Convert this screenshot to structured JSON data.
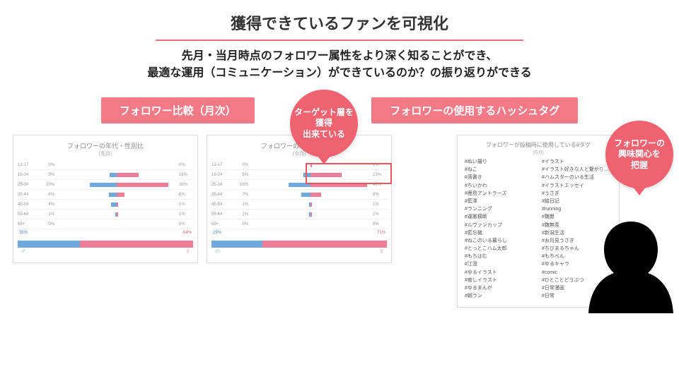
{
  "header": {
    "title": "獲得できているファンを可視化",
    "subtitle_l1": "先月・当月時点のフォロワー属性をより深く知ることができ、",
    "subtitle_l2": "最適な運用（コミュニケーション）ができているのか？の振り返りができる"
  },
  "tags": {
    "left": "フォロワー比較（月次）",
    "right": "フォロワーの使用するハッシュタグ"
  },
  "callouts": {
    "left": "ターゲット層を\n獲得\n出来ている",
    "right": "フォロワーの\n興味関心を\n把握"
  },
  "panels": {
    "age_title": "フォロワーの年代・性別比",
    "period_prev": "(先月)",
    "period_cur": "(今月)",
    "age_rows_prev": [
      {
        "label": "13-17",
        "m": 0,
        "f": 0
      },
      {
        "label": "18-24",
        "m": 5,
        "f": 16
      },
      {
        "label": "25-34",
        "m": 20,
        "f": 38
      },
      {
        "label": "35-44",
        "m": 6,
        "f": 6
      },
      {
        "label": "45-54",
        "m": 4,
        "f": 1
      },
      {
        "label": "55-64",
        "m": 1,
        "f": 1
      },
      {
        "label": "65+",
        "m": 0,
        "f": 0
      }
    ],
    "age_rows_cur": [
      {
        "label": "13-17",
        "m": 0,
        "f": 1
      },
      {
        "label": "18-24",
        "m": 5,
        "f": 23
      },
      {
        "label": "25-34",
        "m": 16,
        "f": 42
      },
      {
        "label": "35-44",
        "m": 7,
        "f": 8
      },
      {
        "label": "45-54",
        "m": 1,
        "f": 1
      },
      {
        "label": "55-64",
        "m": 1,
        "f": 1
      },
      {
        "label": "65+",
        "m": 0,
        "f": 0
      }
    ],
    "gender_prev": {
      "m": 35,
      "f": 64
    },
    "gender_cur": {
      "m": 29,
      "f": 71
    }
  },
  "hashtags": {
    "title": "フォロワーが投稿時に使用している#タグ",
    "period": "[先月]",
    "col1": [
      "#ぬい撮り",
      "#ねこ",
      "#落書き",
      "#ちいかわ",
      "#鹿島アントラーズ",
      "#藍澤",
      "#ランニング",
      "#運搬橫断",
      "#ルヴァンカップ",
      "#藍忘機",
      "#ねこのいる暮らし",
      "#とっとこハム太郎",
      "#もちはむ",
      "#江澄",
      "#ゆるイラスト",
      "#癒しイラスト",
      "#ゆるまんが",
      "#朝ラン"
    ],
    "col2": [
      "#イラスト",
      "#イラスト好きな人と繋がりたい",
      "#ハムスターのいる生活",
      "#イラストエッセイ",
      "#うさぎ",
      "#絵日記",
      "#running",
      "#魏嬰",
      "#魏無羨",
      "#新潟生活",
      "#お月見うさぎ",
      "#ちびまるちゃん",
      "#もちぺん",
      "#ゆるキャラ",
      "#comic",
      "#ひとことどうぶつ",
      "#日常漫画",
      "#日常"
    ]
  },
  "chart_data": [
    {
      "type": "bar",
      "title": "フォロワーの年代・性別比 (先月)",
      "orientation": "diverging-horizontal",
      "categories": [
        "13-17",
        "18-24",
        "25-34",
        "35-44",
        "45-54",
        "55-64",
        "65+"
      ],
      "series": [
        {
          "name": "男性",
          "values": [
            0,
            5,
            20,
            6,
            4,
            1,
            0
          ]
        },
        {
          "name": "女性",
          "values": [
            0,
            16,
            38,
            6,
            1,
            1,
            0
          ]
        }
      ],
      "gender_total": {
        "男性": 35,
        "女性": 64
      }
    },
    {
      "type": "bar",
      "title": "フォロワーの年代・性別比 (今月)",
      "orientation": "diverging-horizontal",
      "categories": [
        "13-17",
        "18-24",
        "25-34",
        "35-44",
        "45-54",
        "55-64",
        "65+"
      ],
      "series": [
        {
          "name": "男性",
          "values": [
            0,
            5,
            16,
            7,
            1,
            1,
            0
          ]
        },
        {
          "name": "女性",
          "values": [
            1,
            23,
            42,
            8,
            1,
            1,
            0
          ]
        }
      ],
      "gender_total": {
        "男性": 29,
        "女性": 71
      }
    }
  ]
}
